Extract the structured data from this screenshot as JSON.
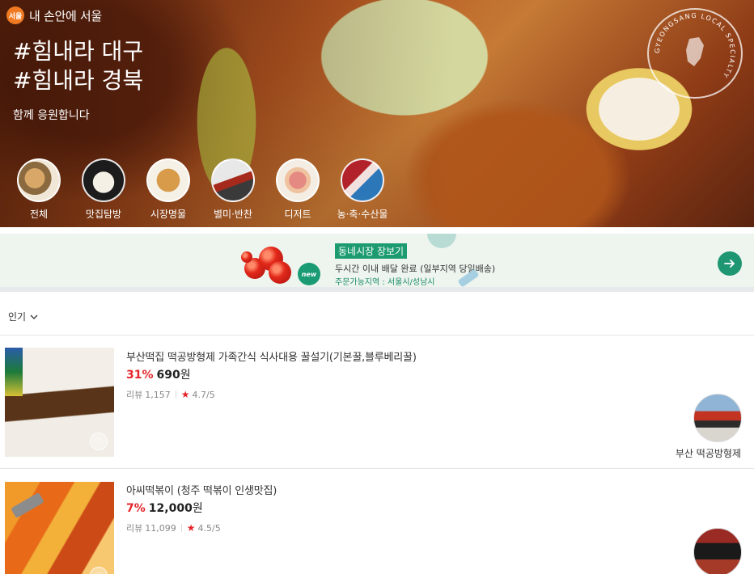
{
  "brand": {
    "logo": "서울",
    "text": "내 손안에 서울"
  },
  "hero": {
    "headline_1": "#힘내라 대구",
    "headline_2": "#힘내라 경북",
    "subline": "함께 응원합니다",
    "seal_text": "GYEONGSANG LOCAL SPECIALTY"
  },
  "categories": [
    {
      "label": "전체",
      "icon": "mixed-food-thumbnail"
    },
    {
      "label": "맛집탐방",
      "icon": "restaurant-dish-thumbnail"
    },
    {
      "label": "시장명물",
      "icon": "market-snack-thumbnail"
    },
    {
      "label": "별미·반찬",
      "icon": "side-dish-thumbnail"
    },
    {
      "label": "디저트",
      "icon": "macaron-thumbnail"
    },
    {
      "label": "농·축·수산물",
      "icon": "meat-seafood-thumbnail"
    }
  ],
  "banner": {
    "badge": "new",
    "title": "동네시장 장보기",
    "description": "두시간 이내 배달 완료 (일부지역 당일배송)",
    "area": "주문가능지역 : 서울시/성남시"
  },
  "sort": {
    "label": "인기"
  },
  "products": [
    {
      "title": "부산떡집 떡공방형제 가족간식 식사대용 꿀설기(기본꿀,블루베리꿀)",
      "discount": "31%",
      "price": "690",
      "currency": "원",
      "review_label": "리뷰",
      "review_count": "1,157",
      "rating": "4.7/5",
      "store": "부산 떡공방형제"
    },
    {
      "title": "아씨떡볶이 (청주 떡볶이 인생맛집)",
      "discount": "7%",
      "price": "12,000",
      "currency": "원",
      "review_label": "리뷰",
      "review_count": "11,099",
      "rating": "4.5/5",
      "store": ""
    }
  ],
  "colors": {
    "accent_green": "#1c9b71",
    "discount_red": "#e5262c",
    "brand_orange": "#f07a22"
  }
}
